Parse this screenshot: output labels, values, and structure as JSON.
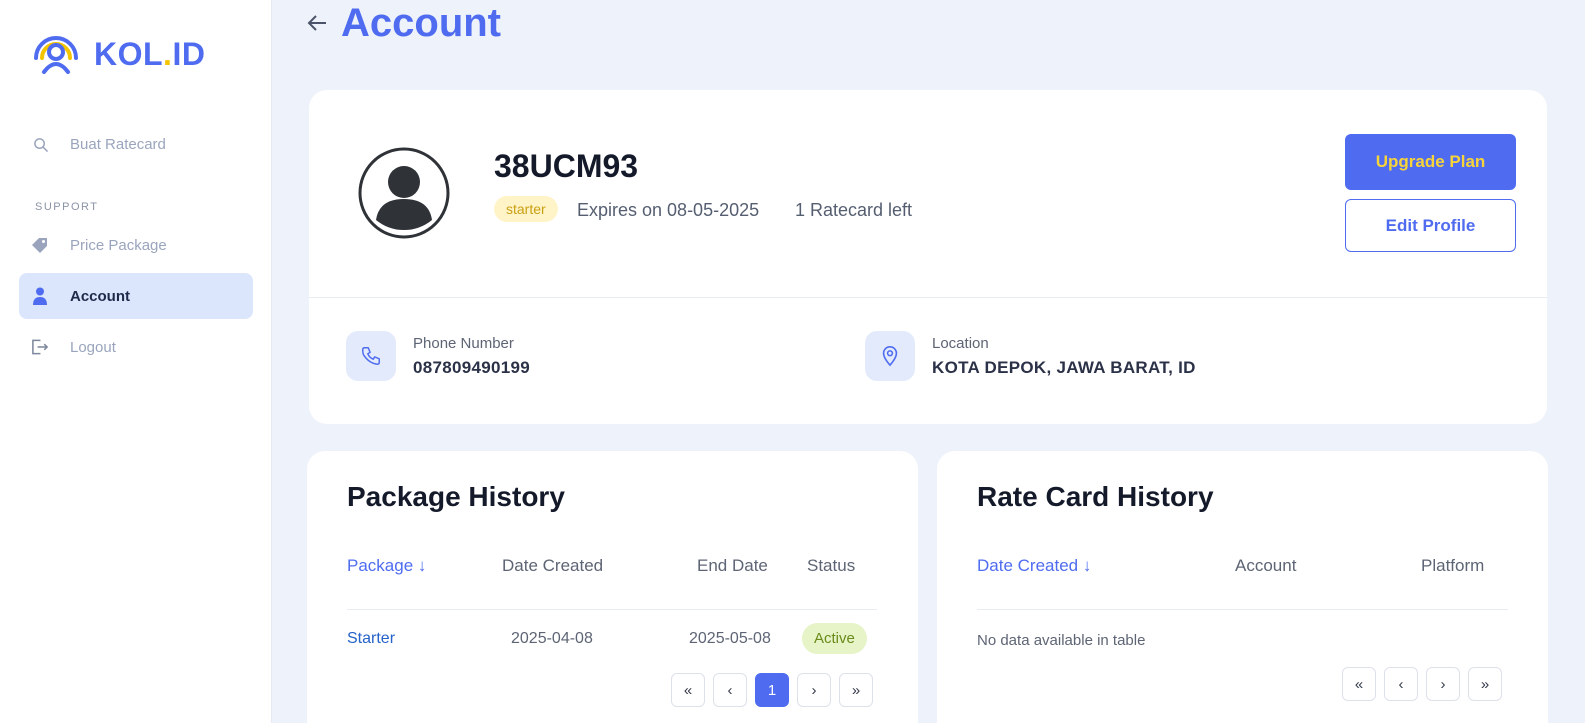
{
  "brand": {
    "name_main": "KOL",
    "name_dot": ".",
    "name_suffix": "ID"
  },
  "sidebar": {
    "items": [
      {
        "label": "Buat Ratecard",
        "icon": "search-icon"
      },
      {
        "label": "Price Package",
        "icon": "tag-icon"
      },
      {
        "label": "Account",
        "icon": "user-icon",
        "active": true
      },
      {
        "label": "Logout",
        "icon": "logout-icon"
      }
    ],
    "section_support": "SUPPORT"
  },
  "header": {
    "title": "Account"
  },
  "profile": {
    "username": "38UCM93",
    "plan_badge": "starter",
    "expires": "Expires on 08-05-2025",
    "ratecard_left": "1 Ratecard left",
    "upgrade_label": "Upgrade Plan",
    "edit_label": "Edit Profile",
    "phone_label": "Phone Number",
    "phone_value": "087809490199",
    "location_label": "Location",
    "location_value": "KOTA DEPOK, JAWA BARAT, ID"
  },
  "package_history": {
    "title": "Package History",
    "columns": [
      "Package ↓",
      "Date Created",
      "End Date",
      "Status"
    ],
    "rows": [
      {
        "package": "Starter",
        "date_created": "2025-04-08",
        "end_date": "2025-05-08",
        "status": "Active"
      }
    ],
    "pager": {
      "first": "«",
      "prev": "‹",
      "current": "1",
      "next": "›",
      "last": "»"
    }
  },
  "ratecard_history": {
    "title": "Rate Card History",
    "columns": [
      "Date Created ↓",
      "Account",
      "Platform"
    ],
    "empty_text": "No data available in table",
    "pager": {
      "first": "«",
      "prev": "‹",
      "next": "›",
      "last": "»"
    }
  },
  "colors": {
    "accent": "#4f6cf0",
    "badge_yellow": "#fff4c8",
    "active_green": "#e6f4c8"
  }
}
